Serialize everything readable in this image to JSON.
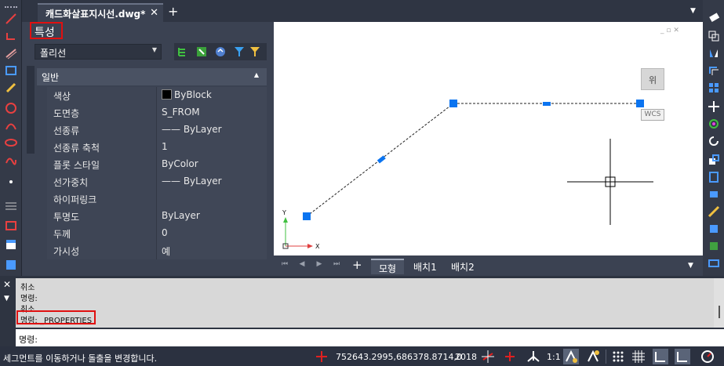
{
  "tabs": {
    "document_tab": "캐드화살표지시선.dwg*",
    "close": "✕",
    "add": "+"
  },
  "properties": {
    "title": "특성",
    "object_type": "폴리선",
    "section": "일반",
    "rows": [
      {
        "key": "색상",
        "value": "ByBlock",
        "swatch": "#000000"
      },
      {
        "key": "도면층",
        "value": "S_FROM"
      },
      {
        "key": "선종류",
        "value": "—— ByLayer"
      },
      {
        "key": "선종류 축척",
        "value": "1"
      },
      {
        "key": "플롯 스타일",
        "value": "ByColor"
      },
      {
        "key": "선가중치",
        "value": "—— ByLayer"
      },
      {
        "key": "하이퍼링크",
        "value": ""
      },
      {
        "key": "투명도",
        "value": "ByLayer"
      },
      {
        "key": "두께",
        "value": "0"
      },
      {
        "key": "가시성",
        "value": "예"
      }
    ]
  },
  "viewport": {
    "viewcube_label": "위",
    "wcs_label": "WCS",
    "axis_y": "Y",
    "axis_x": "X"
  },
  "layout_tabs": [
    "모형",
    "배치1",
    "배치2"
  ],
  "command": {
    "history": [
      "취소",
      "명령:",
      "취소",
      "명령: _PROPERTIES"
    ],
    "prompt": "명령:"
  },
  "status": {
    "message": "세그먼트를 이동하거나 돌출을 변경합니다.",
    "coordinates": "752643.2995,686378.8714,0",
    "year": "2018",
    "scale": "1:1"
  },
  "colors": {
    "accent_red": "#e01010",
    "grip_blue": "#0b74f0",
    "panel": "#3b4252"
  }
}
